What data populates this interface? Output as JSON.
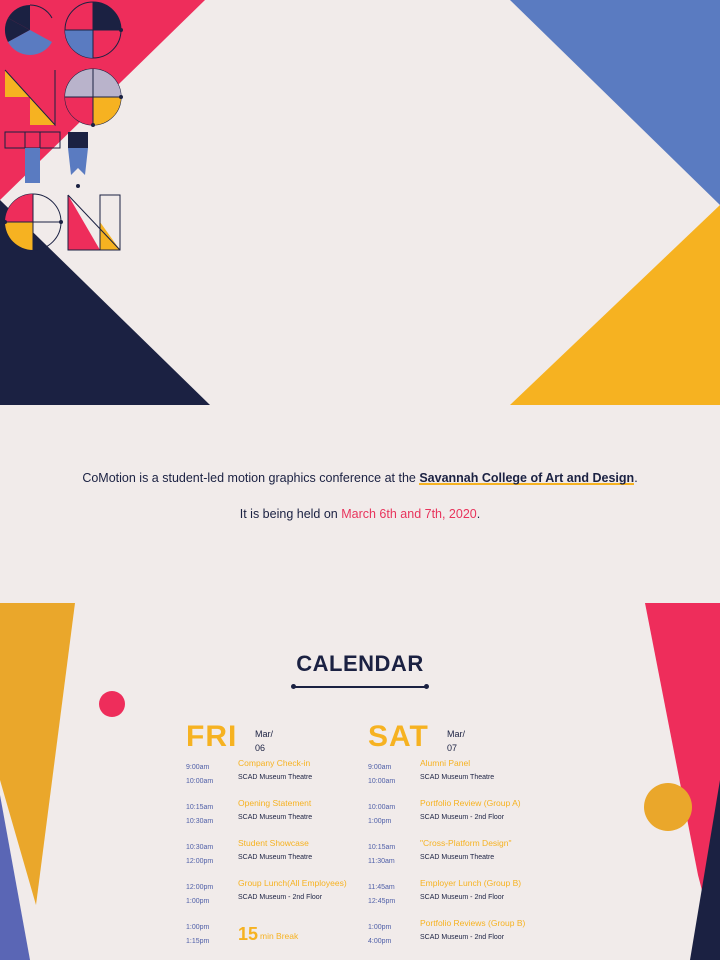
{
  "colors": {
    "pink": "#ee2d5b",
    "blue": "#5a7bc1",
    "navy": "#1b2142",
    "yellow": "#f6b221",
    "bg": "#f1ebea"
  },
  "logo": {
    "alt_text": "CoMotion"
  },
  "intro": {
    "sentence1_before": "CoMotion is a student-led motion graphics conference at the ",
    "school_link": "Savannah College of Art and Design",
    "sentence1_after": ".",
    "sentence2_before": "It is being held on ",
    "dates": "March 6th and 7th, 2020",
    "sentence2_after": "."
  },
  "calendar": {
    "title": "CALENDAR",
    "days": [
      {
        "name": "FRI",
        "month": "Mar/",
        "date": "06",
        "events": [
          {
            "start": "9:00am",
            "end": "10:00am",
            "title": "Company Check-in",
            "location": "SCAD Museum Theatre"
          },
          {
            "start": "10:15am",
            "end": "10:30am",
            "title": "Opening Statement",
            "location": "SCAD Museum Theatre"
          },
          {
            "start": "10:30am",
            "end": "12:00pm",
            "title": "Student Showcase",
            "location": "SCAD Museum Theatre"
          },
          {
            "start": "12:00pm",
            "end": "1:00pm",
            "title": "Group Lunch(All Employees)",
            "location": "SCAD Museum - 2nd Floor"
          },
          {
            "start": "1:00pm",
            "end": "1:15pm",
            "break_number": "15",
            "break_label": "min Break"
          }
        ]
      },
      {
        "name": "SAT",
        "month": "Mar/",
        "date": "07",
        "events": [
          {
            "start": "9:00am",
            "end": "10:00am",
            "title": "Alumni Panel",
            "location": "SCAD Museum Theatre"
          },
          {
            "start": "10:00am",
            "end": "1:00pm",
            "title": "Portfolio Review (Group A)",
            "location": "SCAD Museum - 2nd Floor"
          },
          {
            "start": "10:15am",
            "end": "11:30am",
            "title": "\"Cross-Platform Design\"",
            "location": "SCAD Museum Theatre"
          },
          {
            "start": "11:45am",
            "end": "12:45pm",
            "title": "Employer Lunch (Group B)",
            "location": "SCAD Museum - 2nd Floor"
          },
          {
            "start": "1:00pm",
            "end": "4:00pm",
            "title": "Portfolio Reviews (Group B)",
            "location": "SCAD Museum - 2nd Floor"
          }
        ]
      }
    ]
  }
}
